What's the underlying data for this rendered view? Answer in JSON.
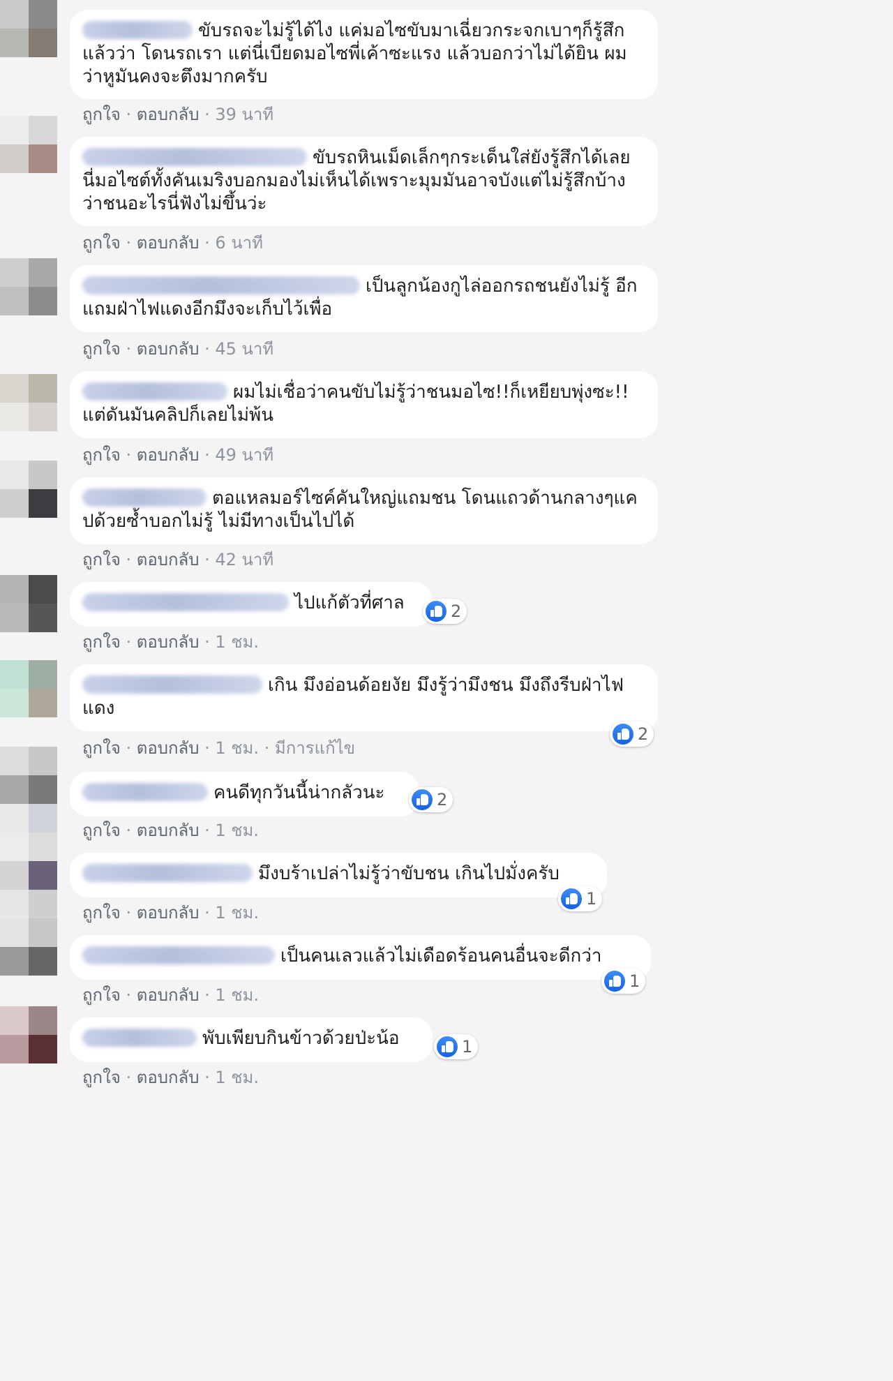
{
  "meta_labels": {
    "like": "ถูกใจ",
    "reply": "ตอบกลับ",
    "dot": " · "
  },
  "comments": [
    {
      "text": "ขับรถจะไม่รู้ได้ไง แค่มอไซขับมาเฉี่ยวกระจกเบาๆก็รู้สึกแล้วว่า โดนรถเรา แต่นี่เบียดมอไซพี่เค้าซะแรง แล้วบอกว่าไม่ได้ยิน ผมว่าหูมันคงจะตึงมากครับ",
      "time": "39 นาที"
    },
    {
      "text": "ขับรถหินเม็ดเล็กๆกระเด็นใส่ยังรู้สึกได้เลย นี่มอไซต์ทั้งคันเมริงบอกมองไม่เห็นได้เพราะมุมมันอาจบังแต่ไม่รู้สึกบ้างว่าชนอะไรนี่ฟังไม่ขึ้นว่ะ",
      "time": "6 นาที"
    },
    {
      "text": "เป็นลูกน้องกูไล่ออกรถชนยังไม่รู้ อีกแถมฝ่าไฟแดงอีกมึงจะเก็บไว้เพื่อ",
      "time": "45 นาที"
    },
    {
      "text": "ผมไม่เชื่อว่าคนขับไม่รู้ว่าชนมอไซ!!ก็เหยียบพุ่งซะ!!แต่ดันมันคลิปก็เลยไม่พ้น",
      "time": "49 นาที"
    },
    {
      "text": "ตอแหลมอร์ไซค์คันใหญ่แถมชน โดนแถวด้านกลางๆแคปด้วยซ้ำบอกไม่รู้ ไม่มีทางเป็นไปได้",
      "time": "42 นาที"
    },
    {
      "text": "ไปแก้ตัวที่ศาล",
      "time": "1 ชม.",
      "likes": "2"
    },
    {
      "text": "เกิน มึงอ่อนด้อยงัย มึงรู้ว่ามึงชน มึงถึงรีบฝ่าไฟแดง",
      "time": "1 ชม.",
      "edited": "มีการแก้ไข",
      "likes": "2"
    },
    {
      "text": "คนดีทุกวันนี้น่ากลัวนะ",
      "time": "1 ชม.",
      "likes": "2"
    },
    {
      "text": "มึงบร้าเปล่าไม่รู้ว่าขับชน เกินไปมั่งครับ",
      "time": "1 ชม.",
      "likes": "1"
    },
    {
      "text": "เป็นคนเลวแล้วไม่เดือดร้อนคนอื่นจะดีกว่า",
      "time": "1 ชม.",
      "likes": "1"
    },
    {
      "text": "พับเพียบกินข้าวด้วยป่ะน้อ",
      "time": "1 ชม.",
      "likes": "1"
    }
  ]
}
